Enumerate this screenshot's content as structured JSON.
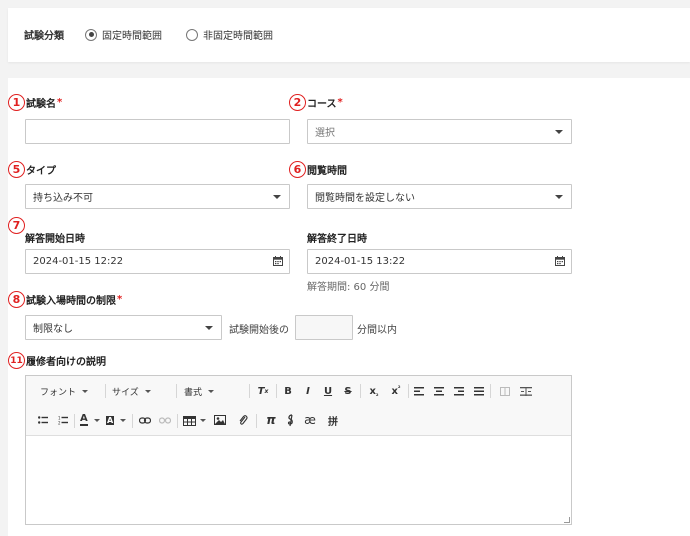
{
  "category": {
    "label": "試験分類",
    "options": [
      {
        "label": "固定時間範囲",
        "selected": true
      },
      {
        "label": "非固定時間範囲",
        "selected": false
      }
    ]
  },
  "markers": {
    "m1": "1",
    "m2": "2",
    "m5": "5",
    "m6": "6",
    "m7": "7",
    "m8": "8",
    "m11": "11"
  },
  "fields": {
    "exam_name": {
      "label": "試験名",
      "required": "*",
      "value": ""
    },
    "course": {
      "label": "コース",
      "required": "*",
      "placeholder": "選択"
    },
    "type": {
      "label": "タイプ",
      "value": "持ち込み不可"
    },
    "view_time": {
      "label": "閲覧時間",
      "value": "閲覧時間を設定しない"
    },
    "answer_start": {
      "label": "解答開始日時",
      "value": "2024-01-15 12:22"
    },
    "answer_end": {
      "label": "解答終了日時",
      "value": "2024-01-15 13:22",
      "hint": "解答期間: 60 分間"
    },
    "entry_limit": {
      "label": "試験入場時間の制限",
      "required": "*",
      "value": "制限なし",
      "prefix": "試験開始後の",
      "minutes": "",
      "suffix": "分間以内"
    },
    "description": {
      "label": "履修者向けの説明",
      "content": ""
    }
  },
  "toolbar": {
    "font": "フォント",
    "size": "サイズ",
    "format": "書式",
    "bold": "B",
    "italic": "I",
    "underline": "U",
    "strike": "S",
    "pi": "π",
    "ae": "æ",
    "hash": "拼"
  }
}
